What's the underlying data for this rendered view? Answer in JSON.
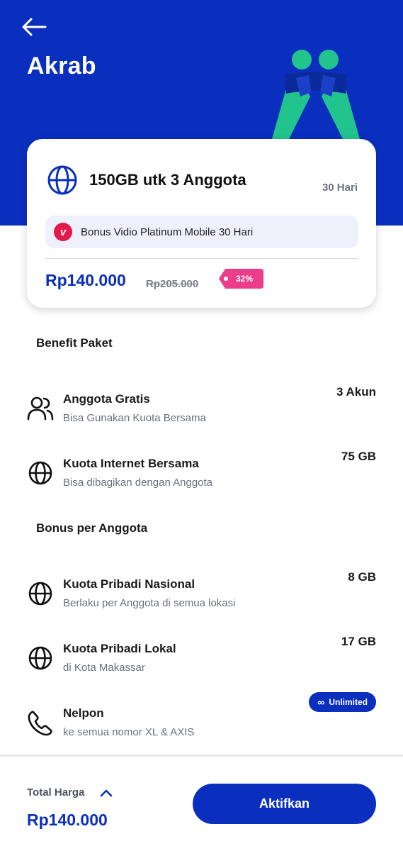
{
  "header": {
    "title": "Akrab",
    "back_icon": "arrow-left-icon",
    "background_color": "#0a2fbf",
    "illustration": "two-people-hugging-illustration"
  },
  "package": {
    "icon": "globe-icon",
    "name": "150GB utk 3 Anggota",
    "duration": "30 Hari",
    "bonus": {
      "icon": "vidio-logo-icon",
      "text": "Bonus Vidio Platinum Mobile 30 Hari"
    },
    "price": "Rp140.000",
    "original_price": "Rp205.000",
    "discount": "32%",
    "discount_color": "#ec3d8c"
  },
  "benefit_section": {
    "title": "Benefit Paket",
    "items": [
      {
        "icon": "users-icon",
        "name": "Anggota Gratis",
        "desc": "Bisa Gunakan Kuota Bersama",
        "value": "3 Akun"
      },
      {
        "icon": "globe-icon",
        "name": "Kuota Internet Bersama",
        "desc": "Bisa dibagikan dengan Anggota",
        "value": "75 GB"
      }
    ]
  },
  "bonus_section": {
    "title": "Bonus per Anggota",
    "items": [
      {
        "icon": "globe-icon",
        "name": "Kuota Pribadi Nasional",
        "desc": "Berlaku per Anggota di semua lokasi",
        "value": "8 GB"
      },
      {
        "icon": "globe-icon",
        "name": "Kuota Pribadi Lokal",
        "desc": "di Kota Makassar",
        "value": "17 GB"
      },
      {
        "icon": "phone-icon",
        "name": "Nelpon",
        "desc": "ke semua nomor XL & AXIS",
        "value": "Unlimited",
        "value_icon": "infinity-icon"
      }
    ]
  },
  "footer": {
    "total_label": "Total Harga",
    "total_price": "Rp140.000",
    "chevron_icon": "chevron-up-icon",
    "button_label": "Aktifkan"
  }
}
